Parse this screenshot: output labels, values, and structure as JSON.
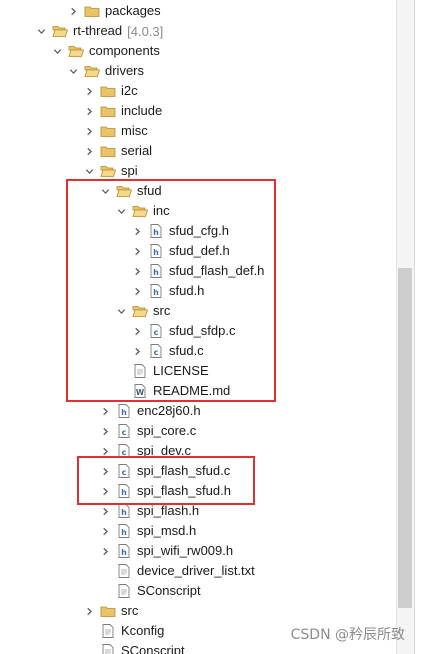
{
  "tree": [
    {
      "label": "packages",
      "level": 2,
      "expanded": false,
      "icon": "folder-icon",
      "name": "folder-packages"
    },
    {
      "label": "rt-thread",
      "version": "[4.0.3]",
      "level": 1,
      "expanded": true,
      "icon": "folder-open-icon",
      "name": "folder-rt-thread"
    },
    {
      "label": "components",
      "level": 2,
      "expanded": true,
      "icon": "folder-open-icon",
      "name": "folder-components"
    },
    {
      "label": "drivers",
      "level": 3,
      "expanded": true,
      "icon": "folder-open-icon",
      "name": "folder-drivers"
    },
    {
      "label": "i2c",
      "level": 4,
      "expanded": false,
      "icon": "folder-icon",
      "name": "folder-i2c"
    },
    {
      "label": "include",
      "level": 4,
      "expanded": false,
      "icon": "folder-icon",
      "name": "folder-include"
    },
    {
      "label": "misc",
      "level": 4,
      "expanded": false,
      "icon": "folder-icon",
      "name": "folder-misc"
    },
    {
      "label": "serial",
      "level": 4,
      "expanded": false,
      "icon": "folder-icon",
      "name": "folder-serial"
    },
    {
      "label": "spi",
      "level": 4,
      "expanded": true,
      "icon": "folder-open-icon",
      "name": "folder-spi"
    },
    {
      "label": "sfud",
      "level": 5,
      "expanded": true,
      "icon": "folder-open-icon",
      "name": "folder-sfud"
    },
    {
      "label": "inc",
      "level": 6,
      "expanded": true,
      "icon": "folder-open-icon",
      "name": "folder-inc"
    },
    {
      "label": "sfud_cfg.h",
      "level": 7,
      "expanded": false,
      "icon": "header-file-icon",
      "name": "file-sfud-cfg-h"
    },
    {
      "label": "sfud_def.h",
      "level": 7,
      "expanded": false,
      "icon": "header-file-icon",
      "name": "file-sfud-def-h"
    },
    {
      "label": "sfud_flash_def.h",
      "level": 7,
      "expanded": false,
      "icon": "header-file-icon",
      "name": "file-sfud-flash-def-h"
    },
    {
      "label": "sfud.h",
      "level": 7,
      "expanded": false,
      "icon": "header-file-icon",
      "name": "file-sfud-h"
    },
    {
      "label": "src",
      "level": 6,
      "expanded": true,
      "icon": "folder-open-icon",
      "name": "folder-src-sfud"
    },
    {
      "label": "sfud_sfdp.c",
      "level": 7,
      "expanded": false,
      "icon": "c-file-icon",
      "name": "file-sfud-sfdp-c"
    },
    {
      "label": "sfud.c",
      "level": 7,
      "expanded": false,
      "icon": "c-file-icon",
      "name": "file-sfud-c"
    },
    {
      "label": "LICENSE",
      "level": 6,
      "expanded": null,
      "icon": "text-file-icon",
      "name": "file-license"
    },
    {
      "label": "README.md",
      "level": 6,
      "expanded": null,
      "icon": "markdown-file-icon",
      "name": "file-readme-md"
    },
    {
      "label": "enc28j60.h",
      "level": 5,
      "expanded": false,
      "icon": "header-file-icon",
      "name": "file-enc28j60-h"
    },
    {
      "label": "spi_core.c",
      "level": 5,
      "expanded": false,
      "icon": "c-file-icon",
      "name": "file-spi-core-c"
    },
    {
      "label": "spi_dev.c",
      "level": 5,
      "expanded": false,
      "icon": "c-file-icon",
      "name": "file-spi-dev-c"
    },
    {
      "label": "spi_flash_sfud.c",
      "level": 5,
      "expanded": false,
      "icon": "c-file-icon",
      "name": "file-spi-flash-sfud-c"
    },
    {
      "label": "spi_flash_sfud.h",
      "level": 5,
      "expanded": false,
      "icon": "header-file-icon",
      "name": "file-spi-flash-sfud-h"
    },
    {
      "label": "spi_flash.h",
      "level": 5,
      "expanded": false,
      "icon": "header-file-icon",
      "name": "file-spi-flash-h"
    },
    {
      "label": "spi_msd.h",
      "level": 5,
      "expanded": false,
      "icon": "header-file-icon",
      "name": "file-spi-msd-h"
    },
    {
      "label": "spi_wifi_rw009.h",
      "level": 5,
      "expanded": false,
      "icon": "header-file-icon",
      "name": "file-spi-wifi-rw009-h"
    },
    {
      "label": "device_driver_list.txt",
      "level": 5,
      "expanded": null,
      "icon": "text-file-icon",
      "name": "file-device-driver-list-txt"
    },
    {
      "label": "SConscript",
      "level": 5,
      "expanded": null,
      "icon": "text-file-icon",
      "name": "file-sconscript-spi"
    },
    {
      "label": "src",
      "level": 4,
      "expanded": false,
      "icon": "folder-icon",
      "name": "folder-src-drivers"
    },
    {
      "label": "Kconfig",
      "level": 4,
      "expanded": null,
      "icon": "text-file-icon",
      "name": "file-kconfig"
    },
    {
      "label": "SConscript",
      "level": 4,
      "expanded": null,
      "icon": "text-file-icon",
      "name": "file-sconscript-drivers"
    }
  ],
  "watermark": "CSDN @矜辰所致",
  "colors": {
    "folder": "#e9c46a",
    "folder_edge": "#b8892b",
    "header_letter": "#3a6fb0",
    "c_letter": "#3a6fb0",
    "highlight_box": "#e03131",
    "version": "#8a8a8a"
  }
}
